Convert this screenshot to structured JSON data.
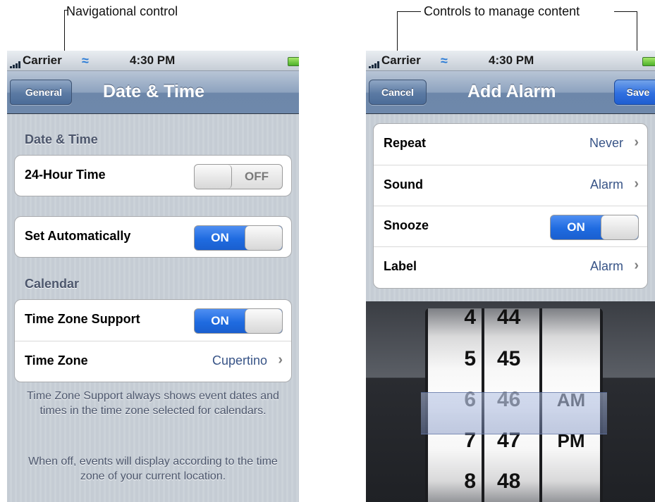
{
  "annotations": {
    "left": "Navigational control",
    "right": "Controls to manage content"
  },
  "left_screen": {
    "status_bar": {
      "carrier": "Carrier",
      "time": "4:30 PM"
    },
    "nav": {
      "back_label": "General",
      "title": "Date & Time"
    },
    "sections": [
      {
        "header": "Date & Time"
      },
      {
        "header": "Calendar"
      }
    ],
    "rows": {
      "hour24": {
        "label": "24-Hour Time",
        "switch": "OFF"
      },
      "set_auto": {
        "label": "Set Automatically",
        "switch": "ON"
      },
      "tz_support": {
        "label": "Time Zone Support",
        "switch": "ON"
      },
      "time_zone": {
        "label": "Time Zone",
        "value": "Cupertino"
      }
    },
    "footnotes": [
      "Time Zone Support always shows event dates and times in the time zone selected for calendars.",
      "When off, events will display according to the time zone of your current location."
    ]
  },
  "right_screen": {
    "status_bar": {
      "carrier": "Carrier",
      "time": "4:30 PM"
    },
    "nav": {
      "cancel_label": "Cancel",
      "title": "Add Alarm",
      "save_label": "Save"
    },
    "rows": {
      "repeat": {
        "label": "Repeat",
        "value": "Never"
      },
      "sound": {
        "label": "Sound",
        "value": "Alarm"
      },
      "snooze": {
        "label": "Snooze",
        "switch": "ON"
      },
      "label": {
        "label": "Label",
        "value": "Alarm"
      }
    },
    "picker": {
      "hours": [
        "4",
        "5",
        "6",
        "7",
        "8"
      ],
      "minutes": [
        "44",
        "45",
        "46",
        "47",
        "48"
      ],
      "ampm": [
        "AM",
        "PM"
      ],
      "selected": {
        "hour": "6",
        "minute": "46",
        "ampm": "AM"
      }
    }
  },
  "colors": {
    "switch_on": "#1f6be0",
    "detail_text": "#385487",
    "nav_bar": "#6e88ab",
    "save_button": "#2f6fe0"
  },
  "icons": [
    "signal-icon",
    "wifi-icon",
    "battery-icon",
    "chevron-right-icon",
    "back-arrow-icon"
  ]
}
